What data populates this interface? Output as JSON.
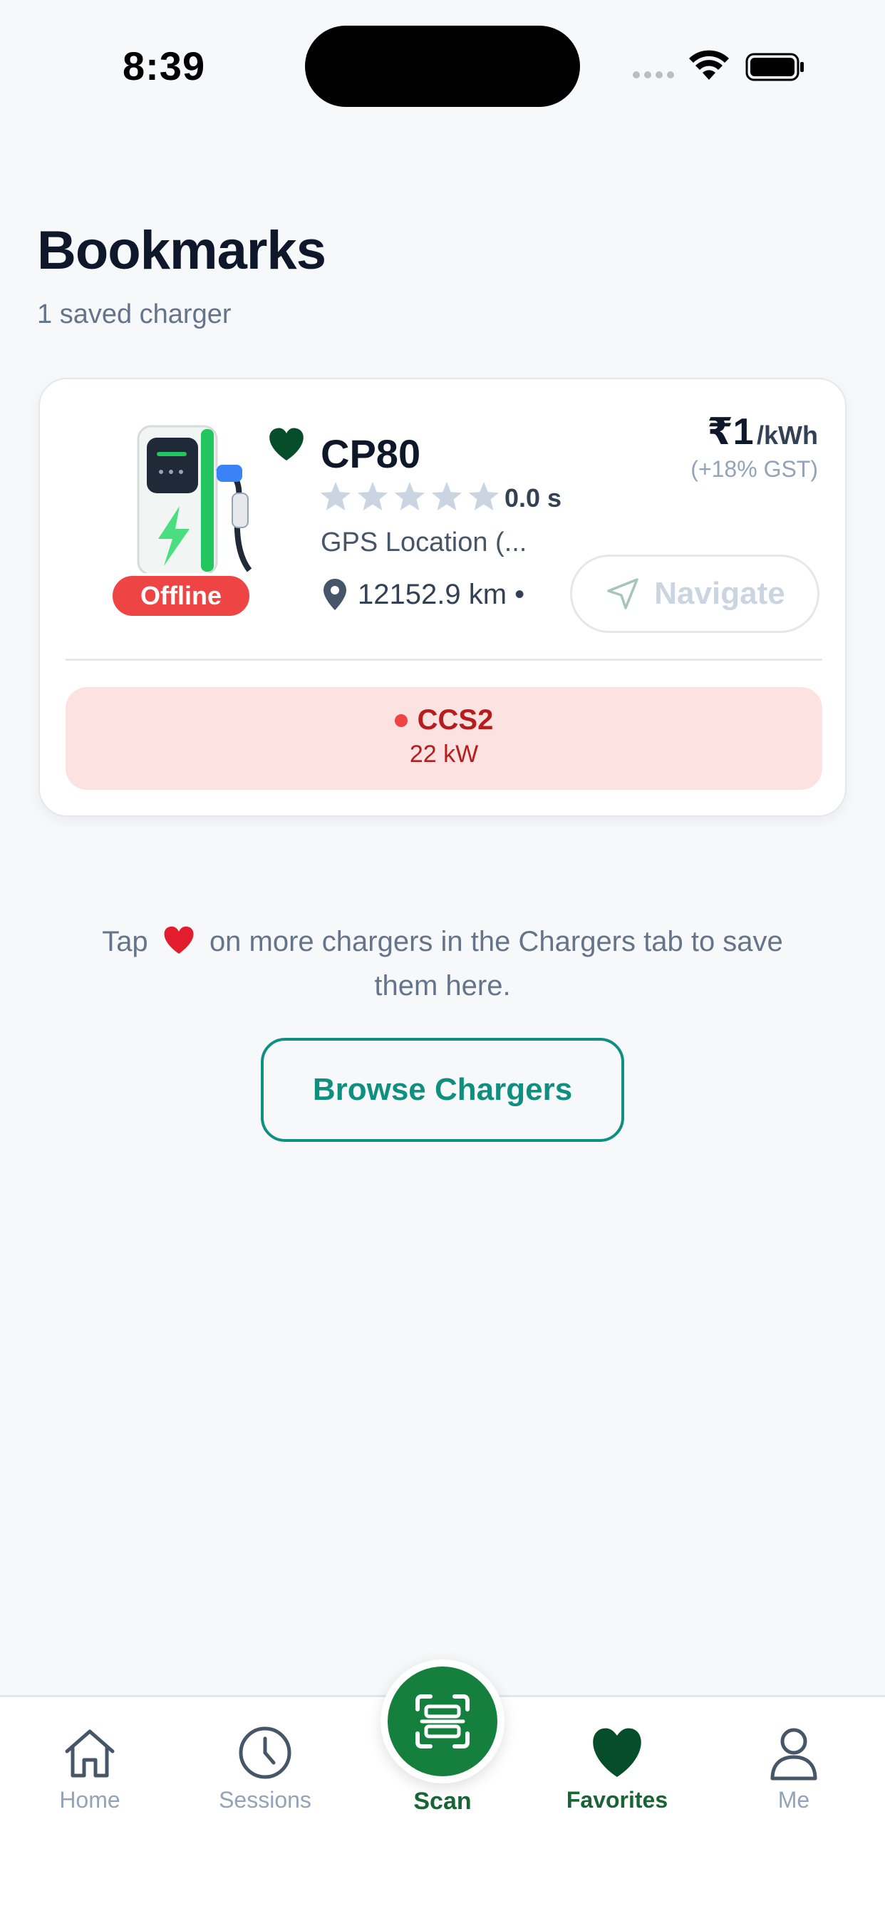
{
  "status_bar": {
    "time": "8:39"
  },
  "header": {
    "title": "Bookmarks",
    "subtitle": "1 saved charger"
  },
  "charger": {
    "name": "CP80",
    "status": "Offline",
    "rating_text": "0.0 s",
    "rating_value": 0.0,
    "max_rating": 5,
    "location": "GPS Location (...",
    "distance": "12152.9 km •",
    "price_main": "₹1",
    "price_unit": "/kWh",
    "price_tax": "(+18% GST)",
    "navigate_label": "Navigate",
    "connector": {
      "type": "CCS2",
      "power": "22 kW"
    }
  },
  "hint": {
    "before": "Tap",
    "after": "on more chargers in the Chargers tab to save them here."
  },
  "browse_button": "Browse Chargers",
  "tabs": [
    {
      "label": "Home",
      "icon": "home-icon",
      "active": false
    },
    {
      "label": "Sessions",
      "icon": "clock-icon",
      "active": false
    },
    {
      "label": "Scan",
      "icon": "scan-icon",
      "active": false
    },
    {
      "label": "Favorites",
      "icon": "heart-icon",
      "active": true
    },
    {
      "label": "Me",
      "icon": "user-icon",
      "active": false
    }
  ],
  "colors": {
    "accent_green": "#15803d",
    "dark_green": "#064e2b",
    "teal": "#0f8f7f",
    "offline_red": "#ef4444",
    "connector_bg": "#fde2e2"
  }
}
